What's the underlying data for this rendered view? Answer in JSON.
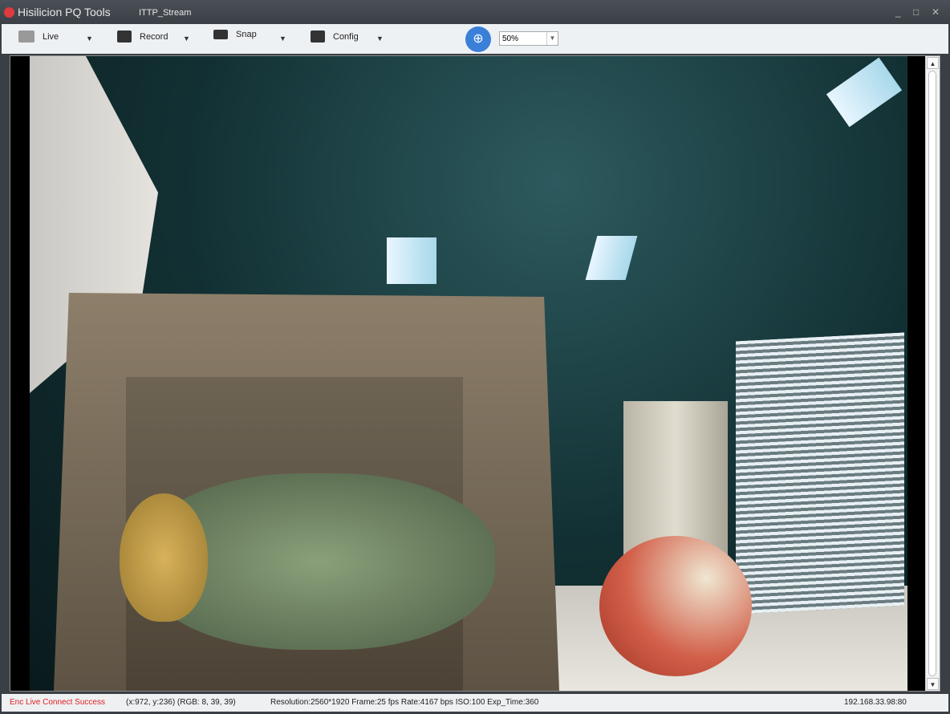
{
  "window": {
    "app_title": "Hisilicion PQ Tools",
    "document_title": "ITTP_Stream",
    "minimize": "_",
    "maximize": "□",
    "close": "✕"
  },
  "toolbar": {
    "live": "Live",
    "record": "Record",
    "snap": "Snap",
    "config": "Config",
    "zoom_value": "50%"
  },
  "status": {
    "connection": "Enc Live Connect Success",
    "connection_color": "#e02020",
    "pixel": "(x:972, y:236) (RGB: 8, 39, 39)",
    "stream": "Resolution:2560*1920  Frame:25 fps  Rate:4167 bps ISO:100 Exp_Time:360",
    "address": "192.168.33.98:80"
  }
}
